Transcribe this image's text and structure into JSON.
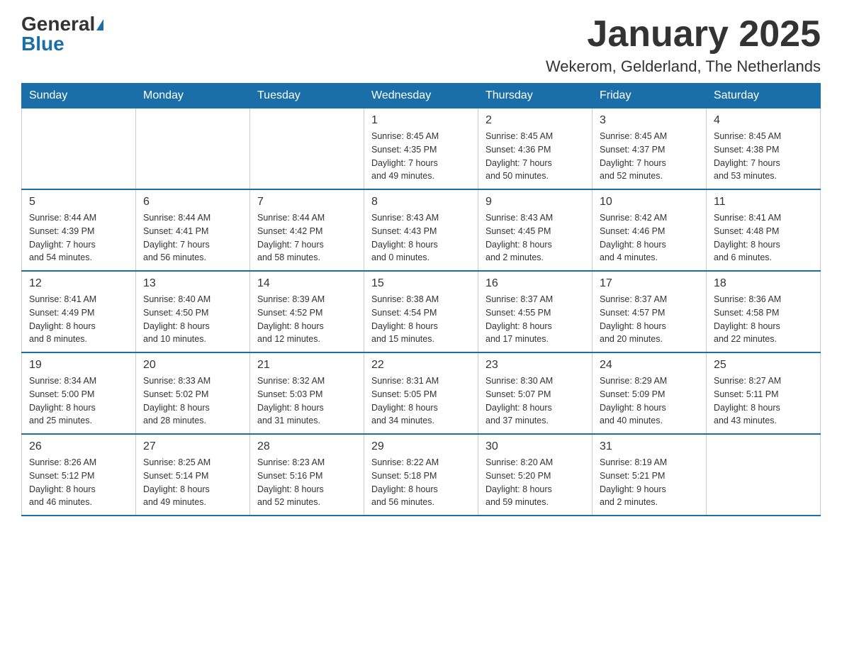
{
  "logo": {
    "general": "General",
    "blue": "Blue"
  },
  "title": "January 2025",
  "location": "Wekerom, Gelderland, The Netherlands",
  "days_of_week": [
    "Sunday",
    "Monday",
    "Tuesday",
    "Wednesday",
    "Thursday",
    "Friday",
    "Saturday"
  ],
  "weeks": [
    [
      {
        "day": "",
        "info": ""
      },
      {
        "day": "",
        "info": ""
      },
      {
        "day": "",
        "info": ""
      },
      {
        "day": "1",
        "info": "Sunrise: 8:45 AM\nSunset: 4:35 PM\nDaylight: 7 hours\nand 49 minutes."
      },
      {
        "day": "2",
        "info": "Sunrise: 8:45 AM\nSunset: 4:36 PM\nDaylight: 7 hours\nand 50 minutes."
      },
      {
        "day": "3",
        "info": "Sunrise: 8:45 AM\nSunset: 4:37 PM\nDaylight: 7 hours\nand 52 minutes."
      },
      {
        "day": "4",
        "info": "Sunrise: 8:45 AM\nSunset: 4:38 PM\nDaylight: 7 hours\nand 53 minutes."
      }
    ],
    [
      {
        "day": "5",
        "info": "Sunrise: 8:44 AM\nSunset: 4:39 PM\nDaylight: 7 hours\nand 54 minutes."
      },
      {
        "day": "6",
        "info": "Sunrise: 8:44 AM\nSunset: 4:41 PM\nDaylight: 7 hours\nand 56 minutes."
      },
      {
        "day": "7",
        "info": "Sunrise: 8:44 AM\nSunset: 4:42 PM\nDaylight: 7 hours\nand 58 minutes."
      },
      {
        "day": "8",
        "info": "Sunrise: 8:43 AM\nSunset: 4:43 PM\nDaylight: 8 hours\nand 0 minutes."
      },
      {
        "day": "9",
        "info": "Sunrise: 8:43 AM\nSunset: 4:45 PM\nDaylight: 8 hours\nand 2 minutes."
      },
      {
        "day": "10",
        "info": "Sunrise: 8:42 AM\nSunset: 4:46 PM\nDaylight: 8 hours\nand 4 minutes."
      },
      {
        "day": "11",
        "info": "Sunrise: 8:41 AM\nSunset: 4:48 PM\nDaylight: 8 hours\nand 6 minutes."
      }
    ],
    [
      {
        "day": "12",
        "info": "Sunrise: 8:41 AM\nSunset: 4:49 PM\nDaylight: 8 hours\nand 8 minutes."
      },
      {
        "day": "13",
        "info": "Sunrise: 8:40 AM\nSunset: 4:50 PM\nDaylight: 8 hours\nand 10 minutes."
      },
      {
        "day": "14",
        "info": "Sunrise: 8:39 AM\nSunset: 4:52 PM\nDaylight: 8 hours\nand 12 minutes."
      },
      {
        "day": "15",
        "info": "Sunrise: 8:38 AM\nSunset: 4:54 PM\nDaylight: 8 hours\nand 15 minutes."
      },
      {
        "day": "16",
        "info": "Sunrise: 8:37 AM\nSunset: 4:55 PM\nDaylight: 8 hours\nand 17 minutes."
      },
      {
        "day": "17",
        "info": "Sunrise: 8:37 AM\nSunset: 4:57 PM\nDaylight: 8 hours\nand 20 minutes."
      },
      {
        "day": "18",
        "info": "Sunrise: 8:36 AM\nSunset: 4:58 PM\nDaylight: 8 hours\nand 22 minutes."
      }
    ],
    [
      {
        "day": "19",
        "info": "Sunrise: 8:34 AM\nSunset: 5:00 PM\nDaylight: 8 hours\nand 25 minutes."
      },
      {
        "day": "20",
        "info": "Sunrise: 8:33 AM\nSunset: 5:02 PM\nDaylight: 8 hours\nand 28 minutes."
      },
      {
        "day": "21",
        "info": "Sunrise: 8:32 AM\nSunset: 5:03 PM\nDaylight: 8 hours\nand 31 minutes."
      },
      {
        "day": "22",
        "info": "Sunrise: 8:31 AM\nSunset: 5:05 PM\nDaylight: 8 hours\nand 34 minutes."
      },
      {
        "day": "23",
        "info": "Sunrise: 8:30 AM\nSunset: 5:07 PM\nDaylight: 8 hours\nand 37 minutes."
      },
      {
        "day": "24",
        "info": "Sunrise: 8:29 AM\nSunset: 5:09 PM\nDaylight: 8 hours\nand 40 minutes."
      },
      {
        "day": "25",
        "info": "Sunrise: 8:27 AM\nSunset: 5:11 PM\nDaylight: 8 hours\nand 43 minutes."
      }
    ],
    [
      {
        "day": "26",
        "info": "Sunrise: 8:26 AM\nSunset: 5:12 PM\nDaylight: 8 hours\nand 46 minutes."
      },
      {
        "day": "27",
        "info": "Sunrise: 8:25 AM\nSunset: 5:14 PM\nDaylight: 8 hours\nand 49 minutes."
      },
      {
        "day": "28",
        "info": "Sunrise: 8:23 AM\nSunset: 5:16 PM\nDaylight: 8 hours\nand 52 minutes."
      },
      {
        "day": "29",
        "info": "Sunrise: 8:22 AM\nSunset: 5:18 PM\nDaylight: 8 hours\nand 56 minutes."
      },
      {
        "day": "30",
        "info": "Sunrise: 8:20 AM\nSunset: 5:20 PM\nDaylight: 8 hours\nand 59 minutes."
      },
      {
        "day": "31",
        "info": "Sunrise: 8:19 AM\nSunset: 5:21 PM\nDaylight: 9 hours\nand 2 minutes."
      },
      {
        "day": "",
        "info": ""
      }
    ]
  ]
}
